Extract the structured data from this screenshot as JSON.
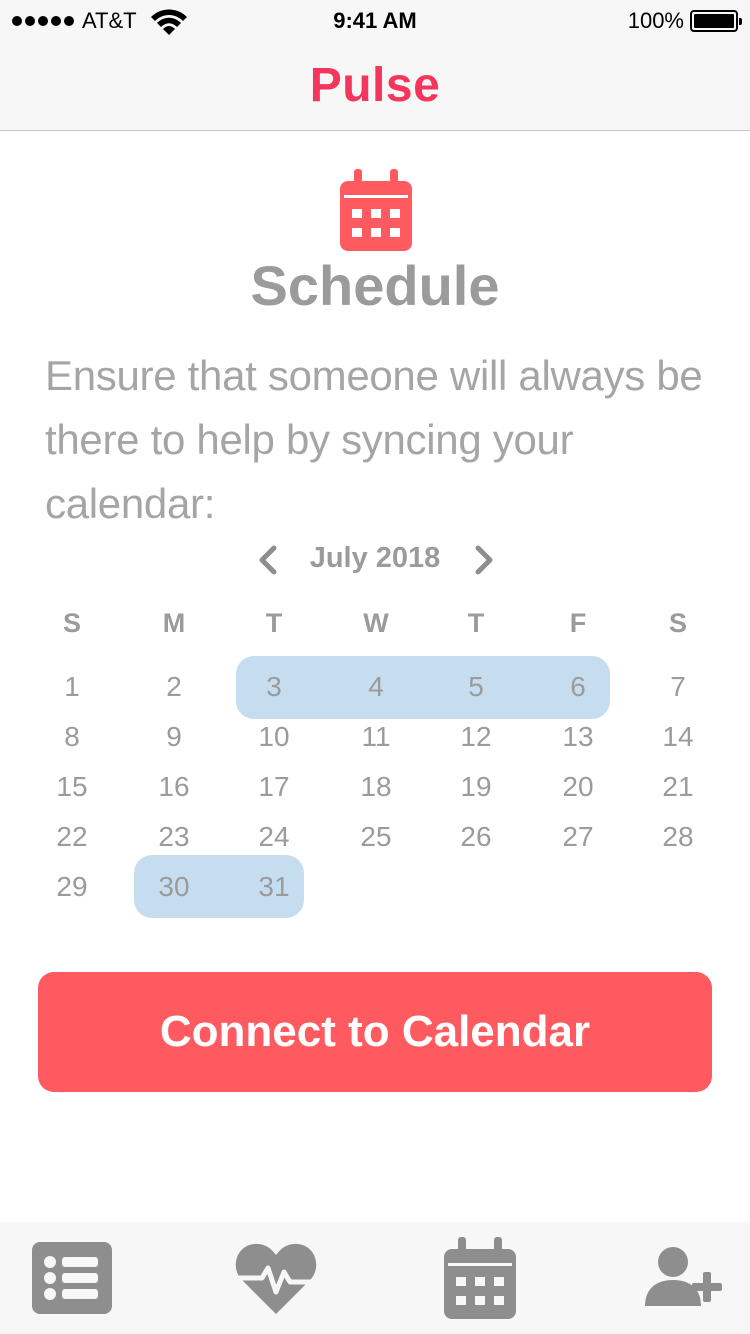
{
  "status_bar": {
    "carrier": "AT&T",
    "time": "9:41 AM",
    "battery": "100%"
  },
  "nav": {
    "title": "Pulse"
  },
  "header": {
    "icon": "calendar-icon",
    "title": "Schedule",
    "description": "Ensure that someone will always be there to help by syncing your calendar:"
  },
  "calendar": {
    "month_label": "July 2018",
    "weekdays": [
      "S",
      "M",
      "T",
      "W",
      "T",
      "F",
      "S"
    ],
    "weeks": [
      [
        "1",
        "2",
        "3",
        "4",
        "5",
        "6",
        "7"
      ],
      [
        "8",
        "9",
        "10",
        "11",
        "12",
        "13",
        "14"
      ],
      [
        "15",
        "16",
        "17",
        "18",
        "19",
        "20",
        "21"
      ],
      [
        "22",
        "23",
        "24",
        "25",
        "26",
        "27",
        "28"
      ],
      [
        "29",
        "30",
        "31",
        "",
        "",
        "",
        ""
      ]
    ],
    "highlighted_ranges": [
      {
        "start": "3",
        "end": "6"
      },
      {
        "start": "30",
        "end": "31"
      }
    ],
    "highlight_color": "#c6ddf0"
  },
  "action": {
    "connect_label": "Connect to Calendar",
    "color": "#ff5a5f"
  },
  "tab_bar": {
    "tabs": [
      {
        "icon": "list-icon",
        "name": "list"
      },
      {
        "icon": "heart-pulse-icon",
        "name": "pulse"
      },
      {
        "icon": "calendar-icon",
        "name": "schedule"
      },
      {
        "icon": "add-user-icon",
        "name": "add-user"
      }
    ]
  },
  "colors": {
    "brand": "#f5365c",
    "text_gray": "#9b9b9b",
    "icon_gray": "#8e8e8e"
  }
}
